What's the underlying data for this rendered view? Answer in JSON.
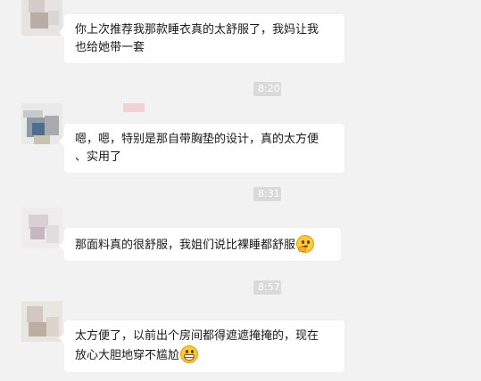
{
  "messages": [
    {
      "lines": [
        "你上次推荐我那款睡衣真的太舒服了，我妈让我",
        "也给她带一套"
      ],
      "emoji": ""
    },
    {
      "timestamp": "8:20",
      "lines": [
        "嗯，嗯，特别是那自带胸垫的设计，真的太方便",
        "、实用了"
      ],
      "emoji": ""
    },
    {
      "timestamp": "8:31",
      "lines": [
        "那面料真的很舒服，我姐们说比裸睡都舒服"
      ],
      "emoji": "thinking-face-icon"
    },
    {
      "timestamp": "8:57",
      "lines": [
        "太方便了，以前出个房间都得遮遮掩掩的，现在",
        "放心大胆地穿不尴尬"
      ],
      "emoji": "grinning-face-icon"
    }
  ],
  "colors": {
    "background": "#f2f2f2",
    "bubble": "#ffffff",
    "timestamp_bg": "#dadada",
    "timestamp_text": "#ffffff"
  }
}
